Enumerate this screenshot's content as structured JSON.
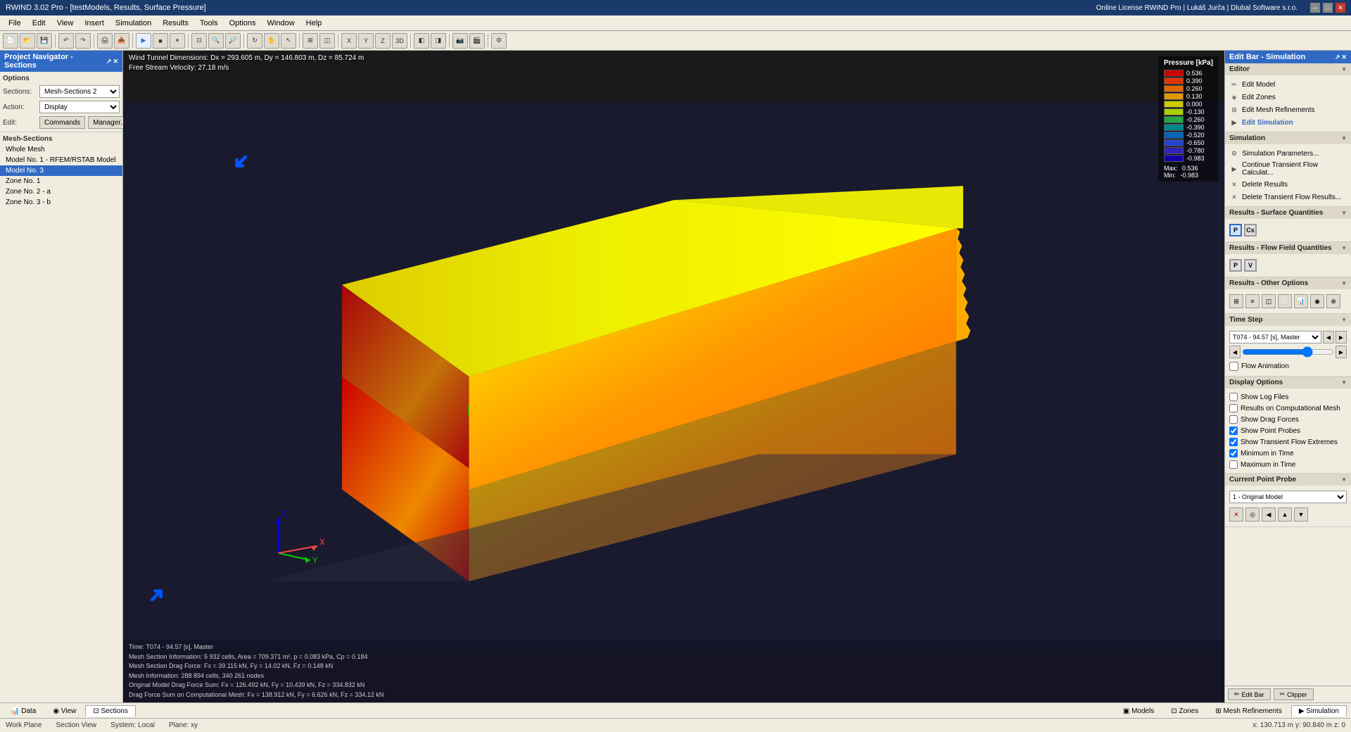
{
  "titlebar": {
    "title": "RWIND 3.02 Pro - [testModels, Results, Surface Pressure]",
    "minimize": "─",
    "restore": "□",
    "close": "✕"
  },
  "menubar": {
    "items": [
      "File",
      "Edit",
      "View",
      "Insert",
      "Simulation",
      "Results",
      "Tools",
      "Options",
      "Window",
      "Help"
    ]
  },
  "license": "Online License RWIND Pro | Lukáš Jurča | Dlubal Software s.r.o.",
  "left_panel": {
    "title": "Project Navigator - Sections",
    "options_label": "Options",
    "sections_label": "Sections:",
    "sections_value": "Mesh-Sections 2",
    "action_label": "Action:",
    "action_value": "Display",
    "edit_label": "Edit:",
    "commands_btn": "Commands",
    "manager_btn": "Manager...",
    "mesh_sections_label": "Mesh-Sections",
    "tree": [
      {
        "label": "Whole Mesh",
        "indent": false,
        "selected": false
      },
      {
        "label": "Model No. 1 - RFEM/RSTAB Model",
        "indent": false,
        "selected": false
      },
      {
        "label": "Model No. 3",
        "indent": false,
        "selected": true
      },
      {
        "label": "Zone No. 1",
        "indent": false,
        "selected": false
      },
      {
        "label": "Zone No. 2 - a",
        "indent": false,
        "selected": false
      },
      {
        "label": "Zone No. 3 - b",
        "indent": false,
        "selected": false
      }
    ]
  },
  "viewport": {
    "info_line1": "Wind Tunnel Dimensions: Dx = 293.605 m, Dy = 146.803 m, Dz = 85.724 m",
    "info_line2": "Free Stream Velocity: 27.18 m/s"
  },
  "legend": {
    "title": "Pressure [kPa]",
    "entries": [
      {
        "value": "0.536",
        "color": "#cc0000"
      },
      {
        "value": "0.390",
        "color": "#e03300"
      },
      {
        "value": "0.260",
        "color": "#e06600"
      },
      {
        "value": "0.130",
        "color": "#e09900"
      },
      {
        "value": "0.000",
        "color": "#cccc00"
      },
      {
        "value": "-0.130",
        "color": "#aacf00"
      },
      {
        "value": "-0.260",
        "color": "#22aa44"
      },
      {
        "value": "-0.390",
        "color": "#008888"
      },
      {
        "value": "-0.520",
        "color": "#0066bb"
      },
      {
        "value": "-0.650",
        "color": "#2244cc"
      },
      {
        "value": "-0.780",
        "color": "#3322bb"
      },
      {
        "value": "-0.983",
        "color": "#1100aa"
      }
    ],
    "max_label": "Max:",
    "max_val": "0.536",
    "min_label": "Min:",
    "min_val": "-0.983"
  },
  "right_panel": {
    "bar_title": "Edit Bar - Simulation",
    "editor_section": "Editor",
    "editor_items": [
      {
        "label": "Edit Model",
        "icon": "✏"
      },
      {
        "label": "Edit Zones",
        "icon": "◈"
      },
      {
        "label": "Edit Mesh Refinements",
        "icon": "⊞"
      },
      {
        "label": "Edit Simulation",
        "icon": "▶",
        "active": true
      }
    ],
    "simulation_section": "Simulation",
    "sim_items": [
      {
        "label": "Simulation Parameters...",
        "icon": "⚙"
      },
      {
        "label": "Continue Transient Flow Calculat...",
        "icon": "▶"
      },
      {
        "label": "Delete Results",
        "icon": "✕"
      },
      {
        "label": "Delete Transient Flow Results...",
        "icon": "✕"
      }
    ],
    "surface_quantities_label": "Results - Surface Quantities",
    "sq_buttons": [
      "P",
      "Cs"
    ],
    "flow_field_label": "Results - Flow Field Quantities",
    "ff_buttons": [
      "P",
      "V"
    ],
    "other_options_label": "Results - Other Options",
    "other_btns": [
      "⊞",
      "≡",
      "◫",
      "⬜",
      "📊",
      "◉",
      "⊕"
    ],
    "time_step_label": "Time Step",
    "time_step_value": "T074 - 94.57 [s], Master",
    "flow_animation_label": "Flow Animation",
    "display_options_label": "Display Options",
    "checkboxes": [
      {
        "label": "Show Log Files",
        "checked": false
      },
      {
        "label": "Results on Computational Mesh",
        "checked": false
      },
      {
        "label": "Show Drag Forces",
        "checked": false
      },
      {
        "label": "Show Point Probes",
        "checked": true
      },
      {
        "label": "Show Transient Flow Extremes",
        "checked": true
      },
      {
        "label": "Minimum in Time",
        "checked": true
      },
      {
        "label": "Maximum in Time",
        "checked": false
      }
    ],
    "current_probe_label": "Current Point Probe",
    "probe_value": "1 - Original Model",
    "probe_btns": [
      "✕",
      "◎",
      "⬅",
      "⬆",
      "⬇"
    ]
  },
  "bottom_info": {
    "line1": "Time: T074 - 94.57 [s], Master",
    "line2": "Mesh Section Information: 5 932 cells, Area = 709.371 m², p = 0.083 kPa, Cp = 0.184",
    "line3": "Mesh Section Drag Force: Fx = 39.115 kN, Fy = 14.02 kN, Fz = 0.148 kN",
    "line4": "Mesh Information: 288 894 cells, 340 261 nodes",
    "line5": "Original Model Drag Force Sum: Fx = 126.492 kN, Fy = 10.439 kN, Fz = 334.832 kN",
    "line6": "Drag Force Sum on Computational Mesh: Fx = 138.912 kN, Fy = 6.626 kN, Fz = 334.12 kN"
  },
  "bottom_tabs": {
    "main_tabs": [
      {
        "label": "▣ Models",
        "active": false
      },
      {
        "label": "⊡ Zones",
        "active": false
      },
      {
        "label": "⊞ Mesh Refinements",
        "active": false
      },
      {
        "label": "▶ Simulation",
        "active": true
      }
    ],
    "nav_tabs": [
      {
        "label": "📊 Data",
        "active": false
      },
      {
        "label": "◉ View",
        "active": false
      },
      {
        "label": "⊡ Sections",
        "active": true
      }
    ]
  },
  "statusbar": {
    "work_plane": "Work Plane",
    "section_view": "Section View",
    "system": "System: Local",
    "plane": "Plane: xy",
    "coordinates": "x: 130.713 m  y: 90.840 m  z: 0"
  },
  "edit_bar_btns": [
    "Edit Bar",
    "Clipper"
  ]
}
